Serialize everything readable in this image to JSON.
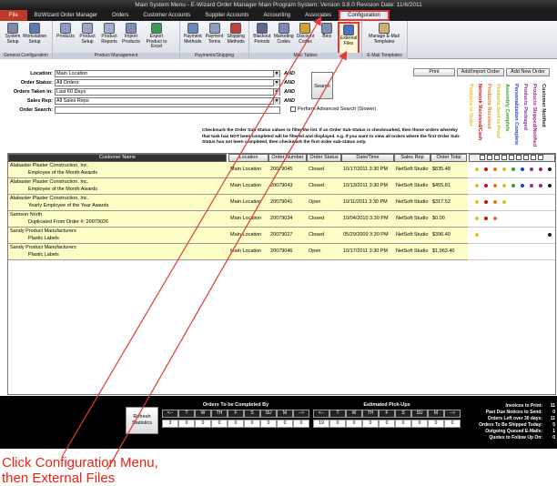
{
  "window": {
    "title": "Main System Menu - E-Wizard Order Manager Main Program System: Version 3.8.0 Revision Date: 11/6/2011"
  },
  "menu": [
    {
      "label": "File"
    },
    {
      "label": "BizWizard Order Manager"
    },
    {
      "label": "Orders"
    },
    {
      "label": "Customer Accounts"
    },
    {
      "label": "Supplier Accounts"
    },
    {
      "label": "Accounting"
    },
    {
      "label": "Associates"
    },
    {
      "label": "Configuration"
    }
  ],
  "ribbon": {
    "groups": [
      {
        "label": "General Configuration",
        "buttons": [
          {
            "label": "System Setup",
            "icon": "gear-icon"
          },
          {
            "label": "Workstation Setup",
            "icon": "computer-icon"
          }
        ]
      },
      {
        "label": "Product Management",
        "buttons": [
          {
            "label": "Products",
            "icon": "box-icon"
          },
          {
            "label": "Product Setup",
            "icon": "box-setup-icon"
          },
          {
            "label": "Product Reports",
            "icon": "report-icon"
          },
          {
            "label": "Import Products",
            "icon": "import-icon"
          },
          {
            "label": "Export Product to Excel",
            "icon": "excel-icon"
          }
        ]
      },
      {
        "label": "Payments/Shipping",
        "buttons": [
          {
            "label": "Payment Methods",
            "icon": "card-icon"
          },
          {
            "label": "Payment Terms",
            "icon": "terms-icon"
          },
          {
            "label": "Shipping Methods",
            "icon": "truck-icon"
          }
        ]
      },
      {
        "label": "Misc Tables",
        "buttons": [
          {
            "label": "Blackout Periods",
            "icon": "calendar-icon"
          },
          {
            "label": "Marketing Codes",
            "icon": "marketing-icon"
          },
          {
            "label": "Discount Codes",
            "icon": "discount-icon"
          },
          {
            "label": "Bins",
            "icon": "bins-icon"
          },
          {
            "label": "External Files",
            "icon": "files-icon"
          }
        ]
      },
      {
        "label": "E-Mail Templates",
        "buttons": [
          {
            "label": "Manage E-Mail Templates",
            "icon": "email-icon"
          }
        ]
      }
    ]
  },
  "filters": {
    "location": {
      "label": "Location:",
      "value": "Main Location"
    },
    "order_status": {
      "label": "Order Status:",
      "value": "All Orders"
    },
    "orders_taken_in": {
      "label": "Orders Taken in:",
      "value": "Last 60 Days"
    },
    "sales_rep": {
      "label": "Sales Rep:",
      "value": "All Sales Reps"
    },
    "order_search": {
      "label": "Order Search:",
      "value": ""
    },
    "and_label": "AND",
    "search_button": "Search",
    "advanced_search": "Perform Advanced Search (Slower)"
  },
  "actions": {
    "print": "Print",
    "add_import": "Add/Import Order",
    "add_new": "Add New Order"
  },
  "instructions": "Checkmark the Order Sub-Status values to filter the list. If an Order Sub-Status is checkmarked, then those orders whereby that task has NOT been completed will be filtered and displayed. e.g. If you want to view all orders where the first Order Sub-Status has not been completed, then checkmark the first order sub-status only.",
  "substatus": [
    {
      "label": "Products to Order",
      "color": "#e8c21a"
    },
    {
      "label": "Network Received/Cash",
      "color": "#cc1010"
    },
    {
      "label": "Products Received",
      "color": "#e07a10"
    },
    {
      "label": "Products Sent to Proof",
      "color": "#d4c020"
    },
    {
      "label": "Assembly Complete",
      "color": "#30a030"
    },
    {
      "label": "Personalization Complete",
      "color": "#2040c0"
    },
    {
      "label": "Products Packaged",
      "color": "#8030a0"
    },
    {
      "label": "Products Shipped/Notified",
      "color": "#a02080"
    },
    {
      "label": "Customer Notified",
      "color": "#202020"
    }
  ],
  "table": {
    "headers": [
      "Customer Name",
      "Location",
      "Order Number",
      "Order Status",
      "Date/Time",
      "Sales Rep",
      "Order Total"
    ],
    "rows": [
      {
        "customer": "Alabaster Plaster Construction, Inc.",
        "sub": "Employee of the Month Awards",
        "location": "Main Location",
        "order": "20079045",
        "status": "Closed",
        "datetime": "10/17/2011 3:30 PM",
        "rep": "NetSoft Studio",
        "total": "$835.48",
        "dots": [
          0,
          1,
          2,
          3,
          4,
          5,
          6,
          7,
          8
        ]
      },
      {
        "customer": "Alabaster Plaster Construction, Inc.",
        "sub": "Employee of the Month Awards",
        "location": "Main Location",
        "order": "20079043",
        "status": "Closed",
        "datetime": "10/13/2011 3:30 PM",
        "rep": "NetSoft Studio",
        "total": "$455.81",
        "dots": [
          0,
          1,
          2,
          3,
          4,
          5,
          6,
          7,
          8
        ]
      },
      {
        "customer": "Alabaster Plaster Construction, Inc.",
        "sub": "Yearly Employee of the Year Awards",
        "location": "Main Location",
        "order": "20079041",
        "status": "Open",
        "datetime": "10/11/2011 3:30 PM",
        "rep": "NetSoft Studio",
        "total": "$317.52",
        "dots": [
          0,
          1,
          2,
          3
        ]
      },
      {
        "customer": "Samson North",
        "sub": "Duplicated From Order #: 20079026",
        "location": "Main Location",
        "order": "20079034",
        "status": "Closed",
        "datetime": "10/04/2010 3:30 PM",
        "rep": "NetSoft Studio",
        "total": "$0.00",
        "dots": [
          0,
          1,
          2
        ]
      },
      {
        "customer": "Sandy Product Manufacturers",
        "sub": "Plastic Labels",
        "location": "Main Location",
        "order": "20079027",
        "status": "Closed",
        "datetime": "05/29/2009 3:30 PM",
        "rep": "NetSoft Studio",
        "total": "$396.40",
        "dots": [
          0,
          8
        ]
      },
      {
        "customer": "Sandy Product Manufacturers",
        "sub": "Plastic Labels",
        "location": "Main Location",
        "order": "20079046",
        "status": "Open",
        "datetime": "10/17/2011 3:30 PM",
        "rep": "NetSoft Studio",
        "total": "$1,963.40",
        "dots": []
      }
    ]
  },
  "footer": {
    "refresh": "Refresh Statistics",
    "to_complete": {
      "title": "Orders To be Completed By",
      "days": [
        "<--",
        "T",
        "W",
        "TH",
        "F",
        "S",
        "SU",
        "M",
        "-->"
      ],
      "values": [
        "3",
        "0",
        "0",
        "0",
        "0",
        "0",
        "0",
        "0",
        "0"
      ]
    },
    "pickups": {
      "title": "Estimated Pick-Ups",
      "days": [
        "<--",
        "T",
        "W",
        "TH",
        "F",
        "S",
        "SU",
        "M",
        "-->"
      ],
      "values": [
        "19",
        "0",
        "0",
        "0",
        "0",
        "0",
        "0",
        "0",
        "0"
      ]
    },
    "stats": [
      {
        "label": "Invoices to Print:",
        "value": "11"
      },
      {
        "label": "Past Due Notices to Send:",
        "value": "0"
      },
      {
        "label": "Orders Left over 30 days:",
        "value": "11"
      },
      {
        "label": "Orders To Be Shipped Today:",
        "value": "5"
      },
      {
        "label": "Outgoing Queued E-Mails:",
        "value": "1"
      },
      {
        "label": "Quotes to Follow Up On:",
        "value": "0"
      }
    ]
  },
  "caption": {
    "line1": "Click Configuration Menu,",
    "line2": "then External Files"
  },
  "colors": {
    "highlight": "#e53935",
    "row_bg": "#fdfdc6",
    "caption": "#e21"
  }
}
